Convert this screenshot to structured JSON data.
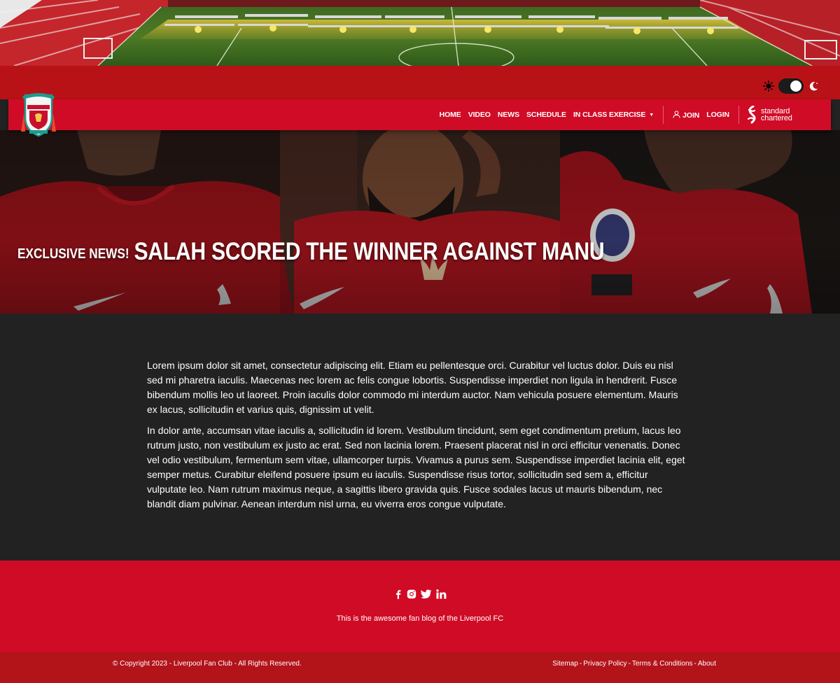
{
  "colors": {
    "primary_red": "#d00b26",
    "dark_red": "#b91216",
    "body_bg": "#222222",
    "text": "#ffffff"
  },
  "theme_toggle": {
    "light_icon": "sun-icon",
    "dark_icon": "moon-icon",
    "state": "dark"
  },
  "nav": {
    "items": [
      {
        "label": "HOME"
      },
      {
        "label": "VIDEO"
      },
      {
        "label": "NEWS"
      },
      {
        "label": "SCHEDULE"
      },
      {
        "label": "IN CLASS EXERCISE"
      }
    ],
    "join_label": "JOIN",
    "login_label": "LOGIN",
    "sponsor_line1": "standard",
    "sponsor_line2": "chartered"
  },
  "hero": {
    "kicker": "EXCLUSIVE NEWS!",
    "headline": "SALAH SCORED THE WINNER AGAINST MANU"
  },
  "article": {
    "paragraphs": [
      "Lorem ipsum dolor sit amet, consectetur adipiscing elit. Etiam eu pellentesque orci. Curabitur vel luctus dolor. Duis eu nisl sed mi pharetra iaculis. Maecenas nec lorem ac felis congue lobortis. Suspendisse imperdiet non ligula in hendrerit. Fusce bibendum mollis leo ut laoreet. Proin iaculis dolor commodo mi interdum auctor. Nam vehicula posuere elementum. Mauris ex lacus, sollicitudin et varius quis, dignissim ut velit.",
      "In dolor ante, accumsan vitae iaculis a, sollicitudin id lorem. Vestibulum tincidunt, sem eget condimentum pretium, lacus leo rutrum justo, non vestibulum ex justo ac erat. Sed non lacinia lorem. Praesent placerat nisl in orci efficitur venenatis. Donec vel odio vestibulum, fermentum sem vitae, ullamcorper turpis. Vivamus a purus sem. Suspendisse imperdiet lacinia elit, eget semper metus. Curabitur eleifend posuere ipsum eu iaculis. Suspendisse risus tortor, sollicitudin sed sem a, efficitur vulputate leo. Nam rutrum maximus neque, a sagittis libero gravida quis. Fusce sodales lacus ut mauris bibendum, nec blandit diam pulvinar. Aenean interdum nisl urna, eu viverra eros congue vulputate."
    ]
  },
  "footer": {
    "socials": [
      "facebook-icon",
      "instagram-icon",
      "twitter-icon",
      "linkedin-icon"
    ],
    "tagline": "This is the awesome fan blog of the Liverpool FC",
    "copyright": "© Copyright 2023 - Liverpool Fan Club - All Rights Reserved.",
    "links": [
      {
        "label": "Sitemap"
      },
      {
        "label": "Privacy Policy"
      },
      {
        "label": "Terms & Conditions"
      },
      {
        "label": "About"
      }
    ],
    "separator": "-"
  }
}
